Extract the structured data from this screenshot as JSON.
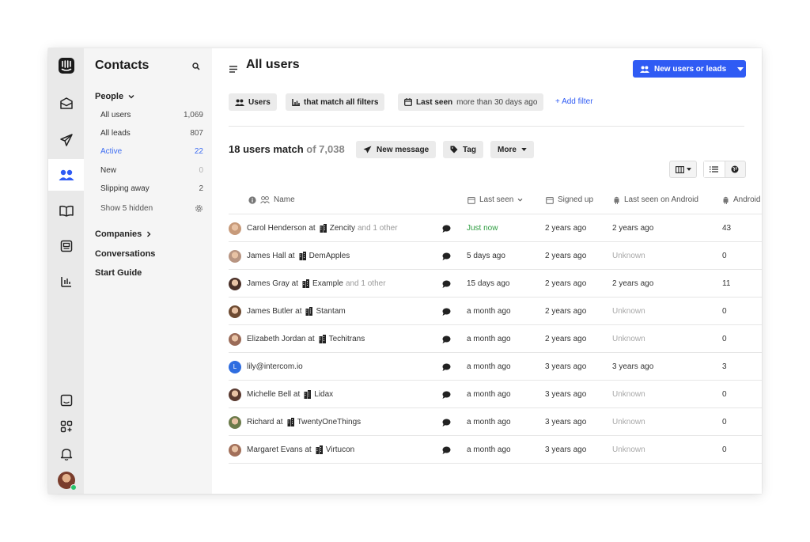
{
  "sidebar": {
    "title": "Contacts",
    "people_label": "People",
    "items": [
      {
        "label": "All users",
        "count": "1,069"
      },
      {
        "label": "All leads",
        "count": "807"
      },
      {
        "label": "Active",
        "count": "22"
      },
      {
        "label": "New",
        "count": "0"
      },
      {
        "label": "Slipping away",
        "count": "2"
      }
    ],
    "show_hidden": "Show 5 hidden",
    "companies": "Companies",
    "conversations": "Conversations",
    "start_guide": "Start Guide"
  },
  "main": {
    "title": "All users",
    "new_button": "New users or leads",
    "filters": {
      "users": "Users",
      "match": "that match all filters",
      "last_seen_bold": "Last seen",
      "last_seen_rest": "more than 30 days ago",
      "add_filter": "+ Add filter"
    },
    "count_text": "18 users match",
    "count_of": "of 7,038",
    "actions": {
      "message": "New message",
      "tag": "Tag",
      "more": "More"
    },
    "columns": [
      "Name",
      "Last seen",
      "Signed up",
      "Last seen on Android",
      "Android"
    ]
  },
  "rows": [
    {
      "name": "Carol Henderson at",
      "company": "Zencity",
      "other": "and 1 other",
      "last_seen": "Just now",
      "signed_up": "2 years ago",
      "android_seen": "2 years ago",
      "android": "43",
      "avatar": "#c79a7a"
    },
    {
      "name": "James Hall at",
      "company": "DemApples",
      "other": "",
      "last_seen": "5 days ago",
      "signed_up": "2 years ago",
      "android_seen": "Unknown",
      "android": "0",
      "avatar": "#b89582"
    },
    {
      "name": "James Gray at",
      "company": "Example",
      "other": "and 1 other",
      "last_seen": "15 days ago",
      "signed_up": "2 years ago",
      "android_seen": "2 years ago",
      "android": "11",
      "avatar": "#4a3028"
    },
    {
      "name": "James Butler at",
      "company": "Stantam",
      "other": "",
      "last_seen": "a month ago",
      "signed_up": "2 years ago",
      "android_seen": "Unknown",
      "android": "0",
      "avatar": "#6e4b32"
    },
    {
      "name": "Elizabeth Jordan at",
      "company": "Techitrans",
      "other": "",
      "last_seen": "a month ago",
      "signed_up": "2 years ago",
      "android_seen": "Unknown",
      "android": "0",
      "avatar": "#9a6b58"
    },
    {
      "name": "lily@intercom.io",
      "company": "",
      "other": "",
      "last_seen": "a month ago",
      "signed_up": "3 years ago",
      "android_seen": "3 years ago",
      "android": "3",
      "avatar": "#2f6de0",
      "letter": "L"
    },
    {
      "name": "Michelle Bell at",
      "company": "Lidax",
      "other": "",
      "last_seen": "a month ago",
      "signed_up": "3 years ago",
      "android_seen": "Unknown",
      "android": "0",
      "avatar": "#5a3a30"
    },
    {
      "name": "Richard at",
      "company": "TwentyOneThings",
      "other": "",
      "last_seen": "a month ago",
      "signed_up": "3 years ago",
      "android_seen": "Unknown",
      "android": "0",
      "avatar": "#6b7a4a"
    },
    {
      "name": "Margaret Evans at",
      "company": "Virtucon",
      "other": "",
      "last_seen": "a month ago",
      "signed_up": "3 years ago",
      "android_seen": "Unknown",
      "android": "0",
      "avatar": "#a2705a"
    }
  ],
  "colors": {
    "accent": "#2f5bf4",
    "active_text": "#3f6ef2",
    "just_now": "#2c9c3f"
  }
}
